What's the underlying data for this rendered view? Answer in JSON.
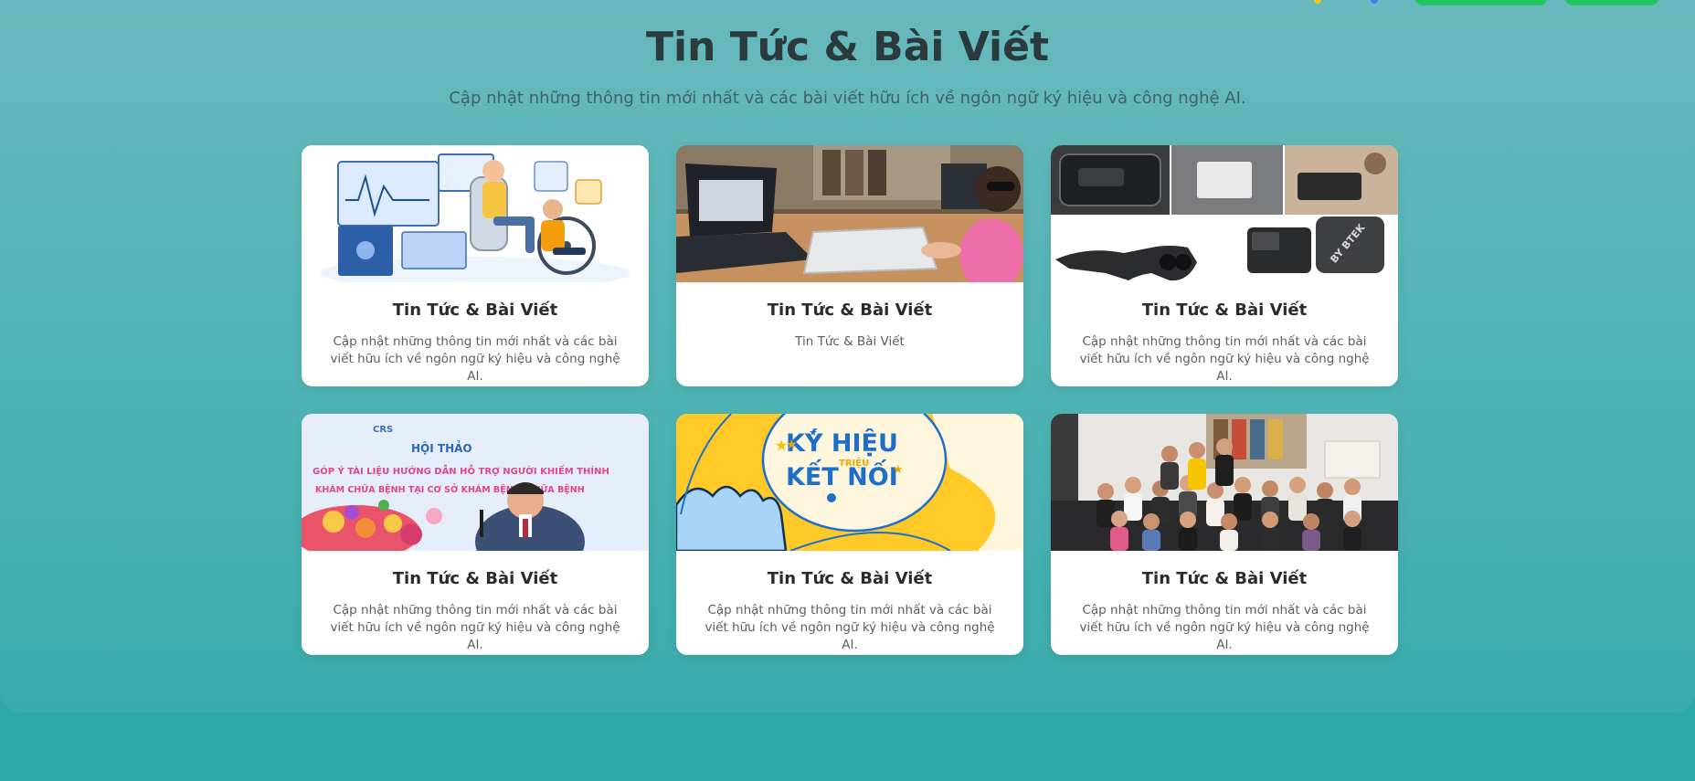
{
  "section": {
    "title": "Tin Tức & Bài Viết",
    "subtitle": "Cập nhật những thông tin mới nhất và các bài viết hữu ích về ngôn ngữ ký hiệu và công nghệ AI."
  },
  "cards": [
    {
      "title": "Tin Tức & Bài Viết",
      "description": "Cập nhật những thông tin mới nhất và các bài viết hữu ích về ngôn ngữ ký hiệu và công nghệ AI.",
      "image": "healthcare-tech-illustration"
    },
    {
      "title": "Tin Tức & Bài Viết",
      "description": "Tin Tức & Bài Viết",
      "image": "child-using-laptop-photo"
    },
    {
      "title": "Tin Tức & Bài Viết",
      "description": "Cập nhật những thông tin mới nhất và các bài viết hữu ích về ngôn ngữ ký hiệu và công nghệ AI.",
      "image": "smart-glasses-device-photo"
    },
    {
      "title": "Tin Tức & Bài Viết",
      "description": "Cập nhật những thông tin mới nhất và các bài viết hữu ích về ngôn ngữ ký hiệu và công nghệ AI.",
      "image": "conference-speaker-photo",
      "image_text": {
        "logo": "CRS",
        "line1": "HỘI THẢO",
        "line2": "GÓP Ý TÀI LIỆU HƯỚNG DẪN HỖ TRỢ NGƯỜI KHIẾM THÍNH",
        "line3": "KHÁM CHỮA BỆNH TẠI CƠ SỞ KHÁM BỆNH, CHỮA BỆNH"
      }
    },
    {
      "title": "Tin Tức & Bài Viết",
      "description": "Cập nhật những thông tin mới nhất và các bài viết hữu ích về ngôn ngữ ký hiệu và công nghệ AI.",
      "image": "sign-language-campaign-poster",
      "image_text": {
        "line1": "KÝ HIỆU",
        "small": "TRIỆU",
        "line2": "KẾT NỐI"
      }
    },
    {
      "title": "Tin Tức & Bài Viết",
      "description": "Cập nhật những thông tin mới nhất và các bài viết hữu ích về ngôn ngữ ký hiệu và công nghệ AI.",
      "image": "group-photo"
    }
  ],
  "colors": {
    "background_top": "#68b9bd",
    "background_bottom": "#2ea8a8",
    "accent_green": "#22c55e",
    "title": "#2b3a3c",
    "card_bg": "#ffffff"
  }
}
